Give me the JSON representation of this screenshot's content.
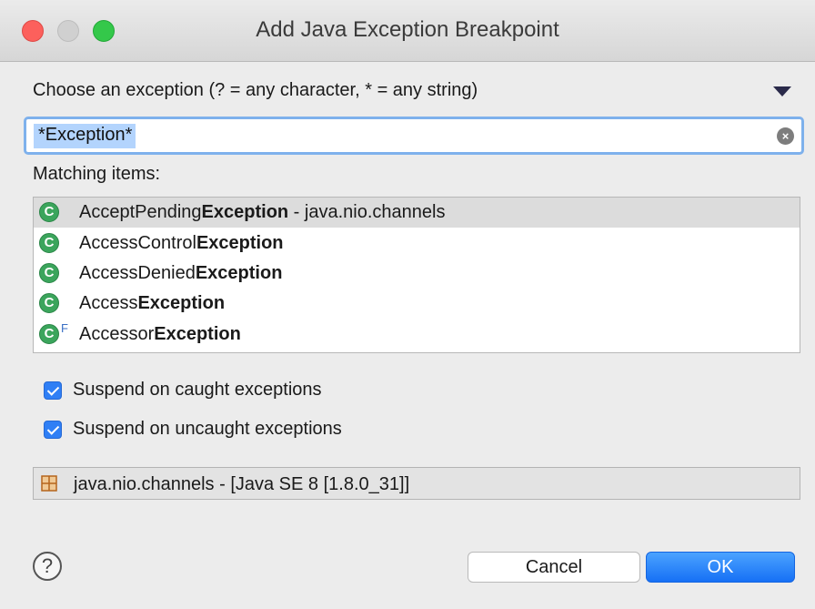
{
  "window": {
    "title": "Add Java Exception Breakpoint"
  },
  "filter": {
    "label": "Choose an exception (? = any character, * = any string)",
    "value": "*Exception*",
    "clear_icon": "clear-icon"
  },
  "matching": {
    "label": "Matching items:",
    "items": [
      {
        "prefix": "AcceptPending",
        "match": "Exception",
        "suffix": " - java.nio.channels",
        "icon": "class-icon",
        "final": "",
        "selected": true
      },
      {
        "prefix": "AccessControl",
        "match": "Exception",
        "suffix": "",
        "icon": "class-icon",
        "final": "",
        "selected": false
      },
      {
        "prefix": "AccessDenied",
        "match": "Exception",
        "suffix": "",
        "icon": "class-icon",
        "final": "",
        "selected": false
      },
      {
        "prefix": "Access",
        "match": "Exception",
        "suffix": "",
        "icon": "class-icon",
        "final": "",
        "selected": false
      },
      {
        "prefix": "Accessor",
        "match": "Exception",
        "suffix": "",
        "icon": "class-icon",
        "final": "F",
        "selected": false
      }
    ]
  },
  "options": {
    "caught": {
      "label": "Suspend on caught exceptions",
      "checked": true
    },
    "uncaught": {
      "label": "Suspend on uncaught exceptions",
      "checked": true
    }
  },
  "status": {
    "text": "java.nio.channels - [Java SE 8 [1.8.0_31]]",
    "icon": "package-icon"
  },
  "buttons": {
    "cancel": "Cancel",
    "ok": "OK",
    "help": "?"
  },
  "colors": {
    "accent": "#2f7ff5",
    "class_icon": "#3ba55c",
    "close": "#fc605c",
    "maximize": "#34c84a"
  }
}
